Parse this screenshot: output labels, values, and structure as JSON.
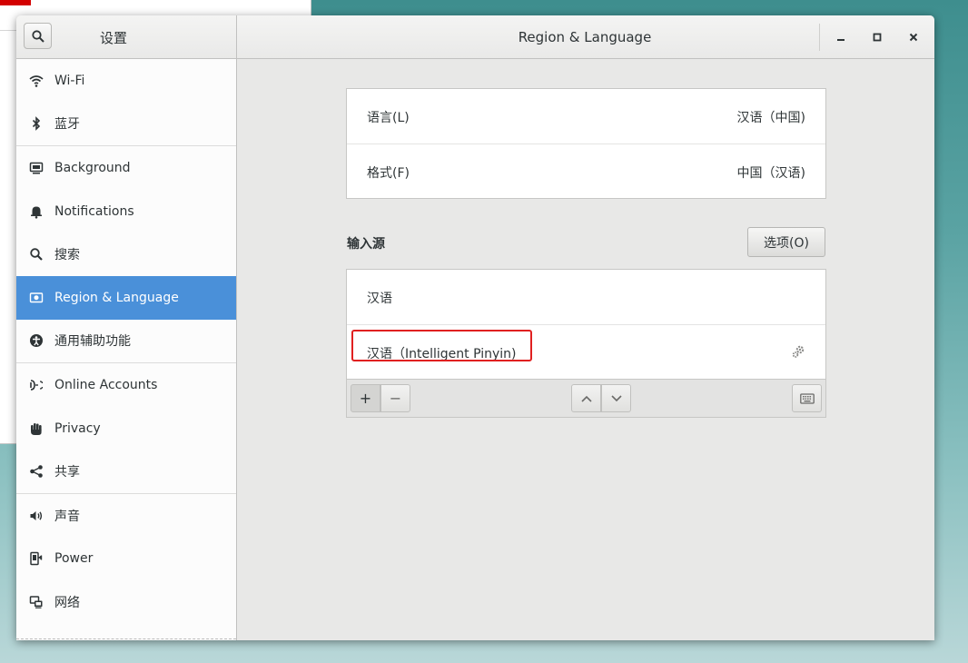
{
  "window": {
    "sidebar_title": "设置",
    "main_title": "Region & Language"
  },
  "sidebar": {
    "items": [
      {
        "label": "Wi-Fi",
        "icon": "wifi-icon"
      },
      {
        "label": "蓝牙",
        "icon": "bluetooth-icon"
      },
      {
        "label": "Background",
        "icon": "background-icon"
      },
      {
        "label": "Notifications",
        "icon": "bell-icon"
      },
      {
        "label": "搜索",
        "icon": "search-icon"
      },
      {
        "label": "Region & Language",
        "icon": "region-flag-icon",
        "active": true
      },
      {
        "label": "通用辅助功能",
        "icon": "accessibility-icon"
      },
      {
        "label": "Online Accounts",
        "icon": "online-accounts-icon"
      },
      {
        "label": "Privacy",
        "icon": "hand-icon"
      },
      {
        "label": "共享",
        "icon": "share-icon"
      },
      {
        "label": "声音",
        "icon": "speaker-icon"
      },
      {
        "label": "Power",
        "icon": "power-plug-icon"
      },
      {
        "label": "网络",
        "icon": "network-icon"
      }
    ]
  },
  "region": {
    "language_label": "语言(L)",
    "language_value": "汉语（中国)",
    "formats_label": "格式(F)",
    "formats_value": "中国（汉语)"
  },
  "input_sources": {
    "section_label": "输入源",
    "options_button": "选项(O)",
    "items": [
      "汉语",
      "汉语（Intelligent Pinyin)"
    ],
    "add_label": "+",
    "remove_label": "−"
  },
  "colors": {
    "accent": "#4a90d9",
    "highlight_box": "#e02020"
  }
}
